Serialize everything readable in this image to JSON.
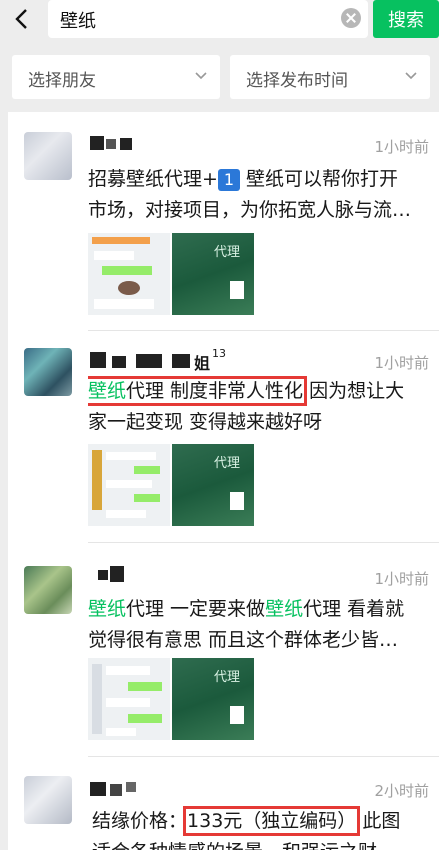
{
  "search": {
    "query": "壁纸",
    "button_label": "搜索"
  },
  "filters": {
    "friend": "选择朋友",
    "time": "选择发布时间"
  },
  "posts": [
    {
      "time": "1小时前",
      "text_line1": "招募壁纸代理+",
      "number_badge": "1",
      "text_line1_rest": " 壁纸可以帮你打开",
      "text_line2": "市场，对接项目，为你拓宽人脉与流…",
      "thumb_text": "代理"
    },
    {
      "name_suffix": "姐",
      "name_sup": "13",
      "time": "1小时前",
      "kw": "壁纸",
      "boxed_rest": "代理 制度非常人性化",
      "line1_rest": " 因为想让大",
      "text_line2": "家一起变现 变得越来越好呀",
      "thumb_text": "代理"
    },
    {
      "time": "1小时前",
      "kw1": "壁纸",
      "mid": "代理 一定要来做",
      "kw2": "壁纸",
      "line1_rest": "代理 看着就",
      "text_line2": "觉得很有意思 而且这个群体老少皆…",
      "thumb_text": "代理"
    },
    {
      "time": "2小时前",
      "prefix": "结缘价格：",
      "boxed": "133元（独立编码）",
      "rest": " 此图",
      "text_line2": "适合各种情感的场景一和强运之财"
    }
  ]
}
